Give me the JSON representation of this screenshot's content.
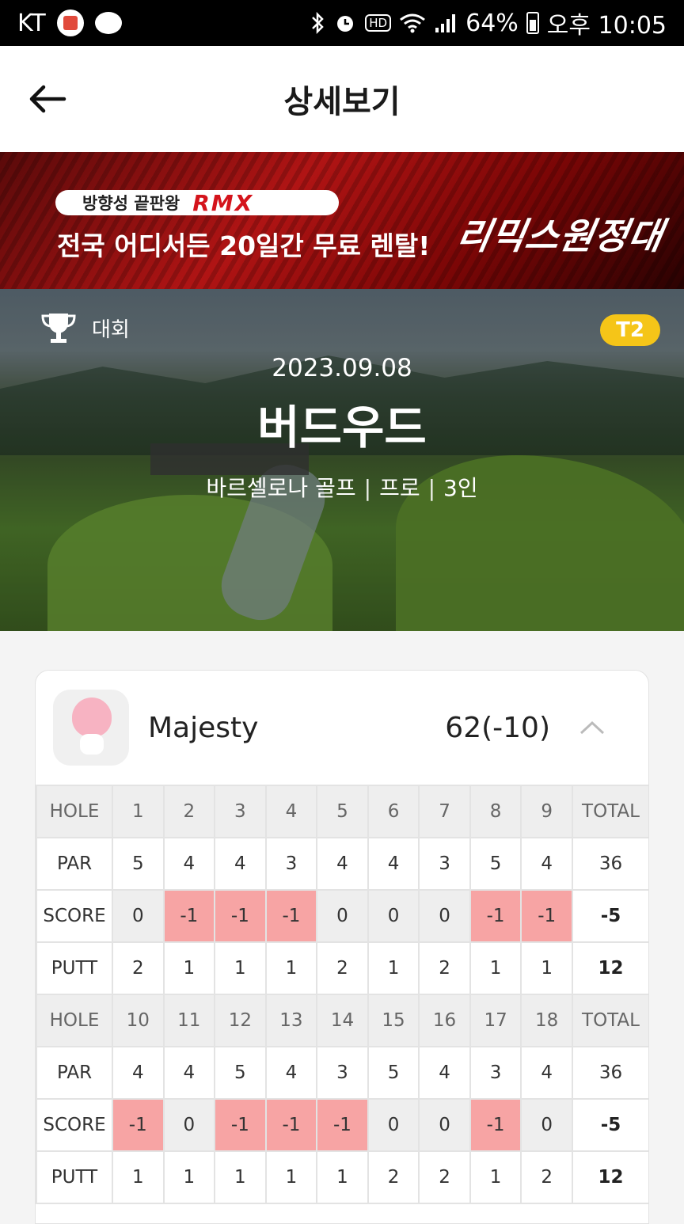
{
  "status_bar": {
    "carrier": "KT",
    "battery": "64%",
    "time": "오후 10:05",
    "hd": "HD"
  },
  "appbar": {
    "title": "상세보기"
  },
  "banner": {
    "pill_text": "방향성 끝판왕",
    "brand": "RMX",
    "main_text": "전국 어디서든 20일간 무료 렌탈!",
    "logo_text": "리믹스원정대"
  },
  "hero": {
    "category": "대회",
    "badge": "T2",
    "date": "2023.09.08",
    "course": "버드우드",
    "sub_venue": "바르셀로나 골프",
    "sub_level": "프로",
    "sub_players": "3인"
  },
  "player": {
    "name": "Majesty",
    "score": "62(-10)"
  },
  "scorecard": {
    "front": {
      "hole": [
        "HOLE",
        "1",
        "2",
        "3",
        "4",
        "5",
        "6",
        "7",
        "8",
        "9",
        "TOTAL"
      ],
      "par": [
        "PAR",
        "5",
        "4",
        "4",
        "3",
        "4",
        "4",
        "3",
        "5",
        "4",
        "36"
      ],
      "score": [
        "SCORE",
        "0",
        "-1",
        "-1",
        "-1",
        "0",
        "0",
        "0",
        "-1",
        "-1",
        "-5"
      ],
      "putt": [
        "PUTT",
        "2",
        "1",
        "1",
        "1",
        "2",
        "1",
        "2",
        "1",
        "1",
        "12"
      ]
    },
    "back": {
      "hole": [
        "HOLE",
        "10",
        "11",
        "12",
        "13",
        "14",
        "15",
        "16",
        "17",
        "18",
        "TOTAL"
      ],
      "par": [
        "PAR",
        "4",
        "4",
        "5",
        "4",
        "3",
        "5",
        "4",
        "3",
        "4",
        "36"
      ],
      "score": [
        "SCORE",
        "-1",
        "0",
        "-1",
        "-1",
        "-1",
        "0",
        "0",
        "-1",
        "0",
        "-5"
      ],
      "putt": [
        "PUTT",
        "1",
        "1",
        "1",
        "1",
        "1",
        "2",
        "2",
        "1",
        "2",
        "12"
      ]
    }
  }
}
